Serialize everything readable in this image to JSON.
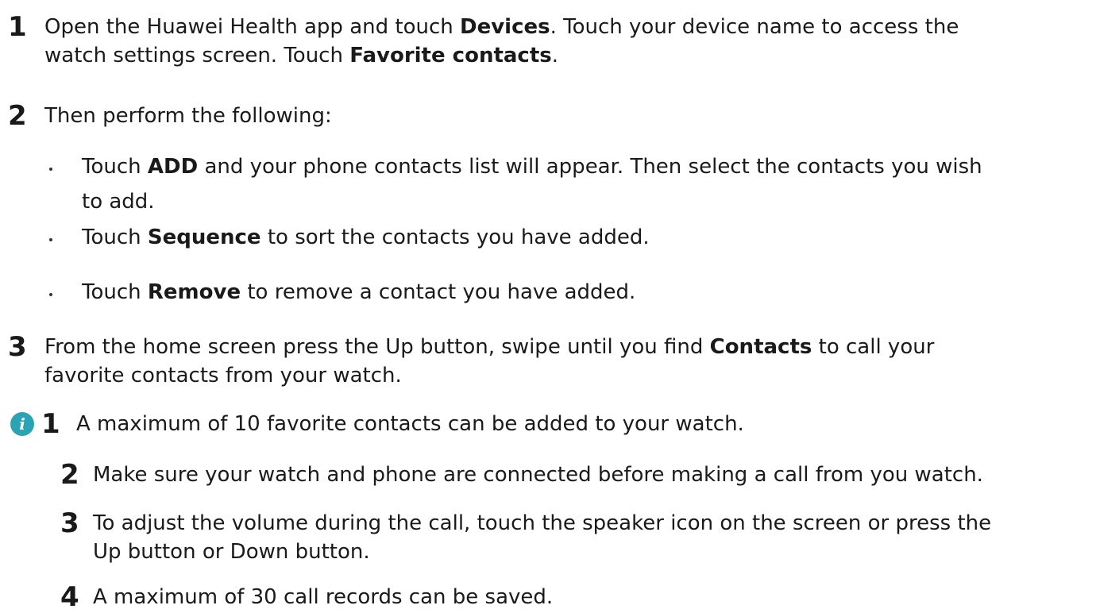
{
  "steps": [
    {
      "number": "1",
      "parts": [
        "Open the Huawei Health app and touch ",
        "Devices",
        ". Touch your device name to access the"
      ],
      "line2_parts": [
        "watch settings screen. Touch ",
        "Favorite contacts",
        "."
      ]
    },
    {
      "number": "2",
      "text": "Then perform the following:",
      "bullets": [
        {
          "parts": [
            "Touch ",
            "ADD",
            " and your phone contacts list will appear. Then select the contacts you wish"
          ],
          "line2": "to add."
        },
        {
          "parts": [
            "Touch ",
            "Sequence",
            " to sort the contacts you have added."
          ]
        },
        {
          "parts": [
            "Touch ",
            "Remove",
            " to remove a contact you have added."
          ]
        }
      ]
    },
    {
      "number": "3",
      "parts": [
        "From the home screen press the Up button, swipe until you find ",
        "Contacts",
        " to call your"
      ],
      "line2": "favorite contacts from your watch."
    }
  ],
  "note": {
    "icon": "info-icon",
    "icon_color": "#2aa3b5",
    "items": [
      {
        "number": "1",
        "text": "A maximum of 10 favorite contacts can be added to your watch."
      },
      {
        "number": "2",
        "text": "Make sure your watch and phone are connected before making a call from you watch."
      },
      {
        "number": "3",
        "text": "To adjust the volume during the call, touch the speaker icon on the screen or press the",
        "line2": "Up button or Down button."
      },
      {
        "number": "4",
        "text": "A maximum of 30 call records can be saved."
      }
    ]
  }
}
